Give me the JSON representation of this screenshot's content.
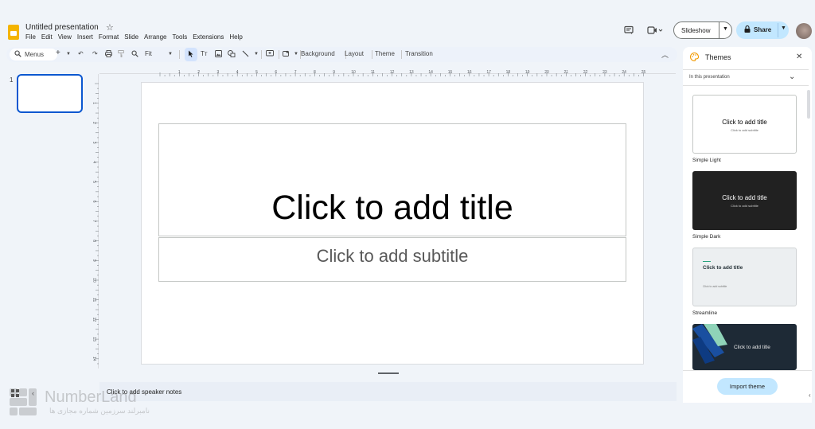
{
  "app": {
    "title": "Untitled presentation",
    "menu": [
      "File",
      "Edit",
      "View",
      "Insert",
      "Format",
      "Slide",
      "Arrange",
      "Tools",
      "Extensions",
      "Help"
    ]
  },
  "header": {
    "slideshow_label": "Slideshow",
    "share_label": "Share"
  },
  "toolbar": {
    "menus_label": "Menus",
    "zoom_label": "Fit",
    "background_label": "Background",
    "layout_label": "Layout",
    "theme_label": "Theme",
    "transition_label": "Transition"
  },
  "filmstrip": {
    "slide_number": "1"
  },
  "rulers": {
    "horizontal_marks": [
      "1",
      "2",
      "3",
      "4",
      "5",
      "6",
      "7",
      "8",
      "9",
      "10",
      "11",
      "12",
      "13",
      "14",
      "15",
      "16",
      "17",
      "18",
      "19",
      "20",
      "21",
      "22",
      "23",
      "24",
      "25"
    ],
    "vertical_marks": [
      "1",
      "2",
      "3",
      "4",
      "5",
      "6",
      "7",
      "8",
      "9",
      "10",
      "11",
      "12",
      "13",
      "14"
    ]
  },
  "slide": {
    "title_placeholder": "Click to add title",
    "subtitle_placeholder": "Click to add subtitle"
  },
  "notes": {
    "placeholder": "Click to add speaker notes"
  },
  "watermark": {
    "name": "NumberLand",
    "subtitle": "نامبرلند سرزمین شماره مجازی ها"
  },
  "themes_panel": {
    "title": "Themes",
    "dropdown_label": "In this presentation",
    "themes": [
      {
        "name": "",
        "card_title": "Click to add title",
        "card_subtitle": "Click to add subtitle"
      },
      {
        "name": "Simple Light",
        "card_title": "Click to add title",
        "card_subtitle": "Click to add subtitle"
      },
      {
        "name": "Simple Dark",
        "card_title": "Click to add title",
        "card_subtitle": "Click to add subtitle"
      },
      {
        "name": "Streamline",
        "card_title": "Click to add title",
        "card_subtitle": "Click to add subtitle"
      }
    ],
    "import_label": "Import theme"
  },
  "colors": {
    "accent": "#0b57d0",
    "share_bg": "#c2e7ff",
    "app_bg": "#f0f4f9",
    "logo": "#f4b400"
  },
  "icons": [
    "slides-logo-icon",
    "star-icon",
    "comment-icon",
    "video-call-icon",
    "lock-icon",
    "search-icon",
    "palette-icon",
    "close-icon"
  ]
}
